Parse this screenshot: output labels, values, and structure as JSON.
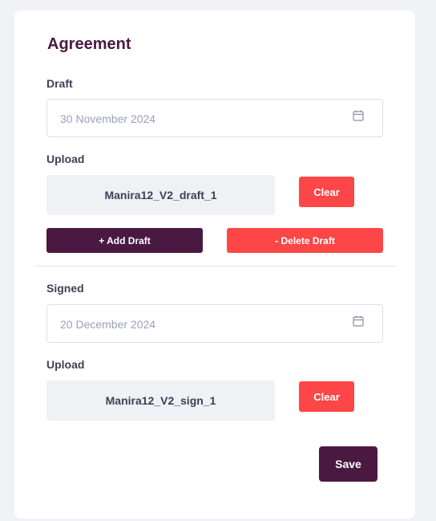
{
  "card": {
    "title": "Agreement",
    "draft": {
      "label": "Draft",
      "date_value": "30 November 2024",
      "upload_label": "Upload",
      "file_name": "Manira12_V2_draft_1",
      "clear_label": "Clear"
    },
    "add_draft_label": "+ Add Draft",
    "delete_draft_label": "- Delete Draft",
    "signed": {
      "label": "Signed",
      "date_value": "20 December 2024",
      "upload_label": "Upload",
      "file_name": "Manira12_V2_sign_1",
      "clear_label": "Clear"
    },
    "save_label": "Save"
  },
  "icons": {
    "calendar": "calendar-icon"
  },
  "colors": {
    "primary": "#4a1942",
    "danger": "#fd4647",
    "background": "#f1f2f6",
    "placeholder_text": "#9aa1b8"
  }
}
